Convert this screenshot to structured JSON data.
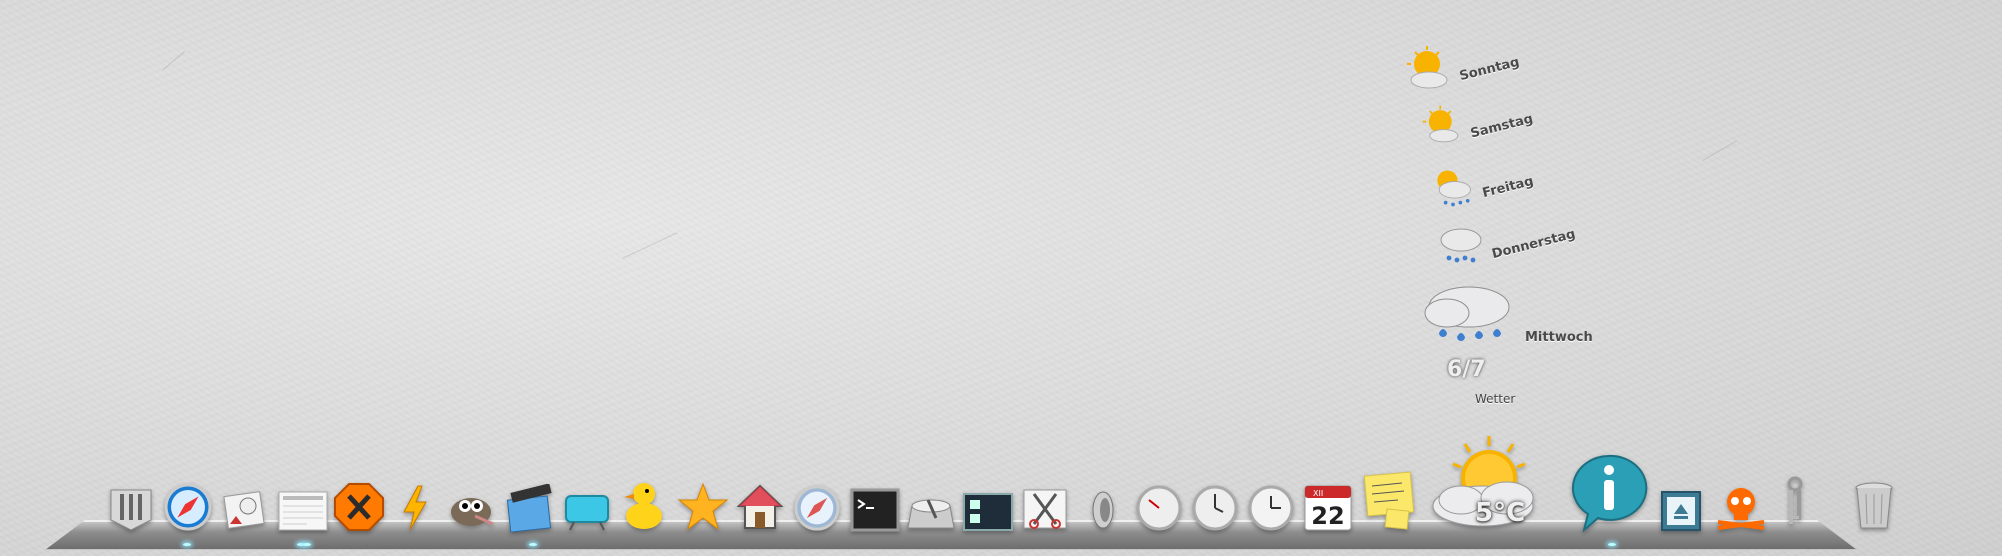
{
  "weather": {
    "widget_label": "Wetter",
    "current_temp": "5°C",
    "forecast": [
      {
        "day": "Sonntag",
        "icon": "sun-cloud-icon"
      },
      {
        "day": "Samstag",
        "icon": "sun-cloud-icon"
      },
      {
        "day": "Freitag",
        "icon": "sun-rain-icon"
      },
      {
        "day": "Donnerstag",
        "icon": "rain-cloud-icon"
      },
      {
        "day": "Mittwoch",
        "icon": "rain-cloud-icon",
        "temp": "6/7"
      }
    ]
  },
  "dock": {
    "calendar_month": "XII",
    "calendar_day": "22",
    "items": [
      {
        "name": "finder-icon"
      },
      {
        "name": "safari-icon"
      },
      {
        "name": "mail-icon"
      },
      {
        "name": "textedit-icon"
      },
      {
        "name": "crossover-icon"
      },
      {
        "name": "bolt-icon"
      },
      {
        "name": "gimp-icon"
      },
      {
        "name": "imovie-icon"
      },
      {
        "name": "tv-icon"
      },
      {
        "name": "cyberduck-icon"
      },
      {
        "name": "star-icon"
      },
      {
        "name": "home-icon"
      },
      {
        "name": "safari-icon"
      },
      {
        "name": "terminal-icon"
      },
      {
        "name": "disk-utility-icon"
      },
      {
        "name": "spaces-icon"
      },
      {
        "name": "scissors-icon"
      },
      {
        "name": "speaker-icon"
      },
      {
        "name": "gauge-icon"
      },
      {
        "name": "dashboard-clock-icon"
      },
      {
        "name": "clock-icon"
      },
      {
        "name": "calendar-icon"
      },
      {
        "name": "stickies-icon"
      },
      {
        "name": "weather-icon"
      },
      {
        "name": "info-icon"
      },
      {
        "name": "eject-icon"
      },
      {
        "name": "skull-icon"
      },
      {
        "name": "keys-icon"
      },
      {
        "name": "trash-icon"
      }
    ]
  },
  "colors": {
    "sun": "#f7b300",
    "cloud": "#e9e9ea",
    "rain": "#3f7fd0",
    "info_teal": "#2a9fb5",
    "crossover_orange": "#ff7a00",
    "calendar_red": "#cc2a2a",
    "sticky_yellow": "#fbe86a"
  }
}
